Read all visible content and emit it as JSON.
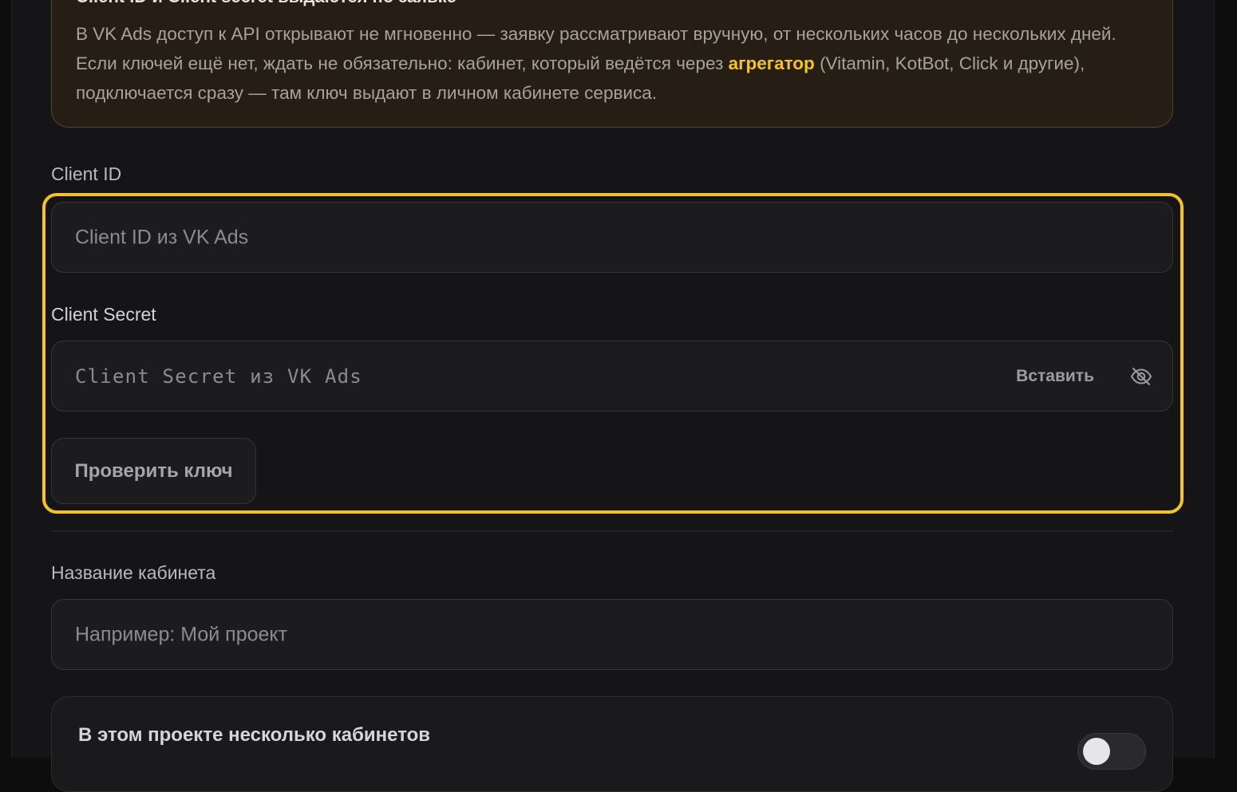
{
  "notice": {
    "title": "Client ID и Client secret выдаются по заявке",
    "text_before": "В VK Ads доступ к API открывают не мгновенно — заявку рассматривают вручную, от нескольких часов до нескольких дней. Если ключей ещё нет, ждать не обязательно: кабинет, который ведётся через ",
    "link": "агрегатор",
    "text_after": " (Vitamin, KotBot, Click и другие), подключается сразу — там ключ выдают в личном кабинете сервиса.",
    "accent_color": "#f5c518"
  },
  "client_id": {
    "label": "Client ID",
    "placeholder": "Client ID из VK Ads",
    "value": ""
  },
  "client_secret": {
    "label": "Client Secret",
    "placeholder": "Client Secret из VK Ads",
    "value": "",
    "paste_label": "Вставить",
    "visibility_icon": "eye-off-icon"
  },
  "check_button": {
    "label": "Проверить ключ"
  },
  "cabinet_name": {
    "label": "Название кабинета",
    "placeholder": "Например: Мой проект",
    "value": ""
  },
  "multi_cabinets": {
    "label": "В этом проекте несколько кабинетов",
    "enabled": false
  },
  "highlight_color": "#f5c518"
}
